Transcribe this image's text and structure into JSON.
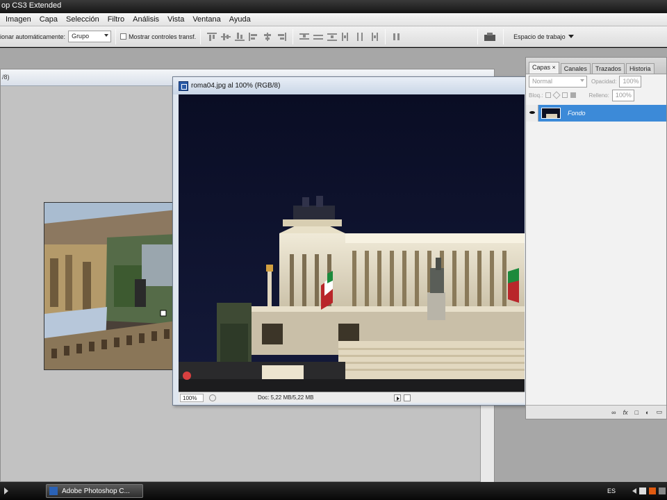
{
  "app": {
    "title": "op CS3 Extended"
  },
  "menu": [
    "Imagen",
    "Capa",
    "Selección",
    "Filtro",
    "Análisis",
    "Vista",
    "Ventana",
    "Ayuda"
  ],
  "options": {
    "auto_select_label": "ionar automáticamente:",
    "auto_select_value": "Grupo",
    "show_transform_label": "Mostrar controles transf.",
    "workspace_label": "Espacio de trabajo"
  },
  "back_window": {
    "title": "/8)"
  },
  "document": {
    "title": "roma04.jpg al 100% (RGB/8)",
    "zoom": "100%",
    "doc_info": "Doc: 5,22 MB/5,22 MB"
  },
  "layers_panel": {
    "tabs": [
      "Capas",
      "Canales",
      "Trazados",
      "Historia"
    ],
    "blend_mode": "Normal",
    "opacity_label": "Opacidad:",
    "opacity_value": "100%",
    "lock_label": "Bloq.:",
    "fill_label": "Relleno:",
    "fill_value": "100%",
    "layer_name": "Fondo"
  },
  "taskbar": {
    "app_button": "Adobe Photoshop C...",
    "lang": "ES"
  },
  "colors": {
    "night_sky": "#0b0f2a",
    "layer_selected": "#3c8ad8",
    "workspace": "#a7a7a7"
  }
}
